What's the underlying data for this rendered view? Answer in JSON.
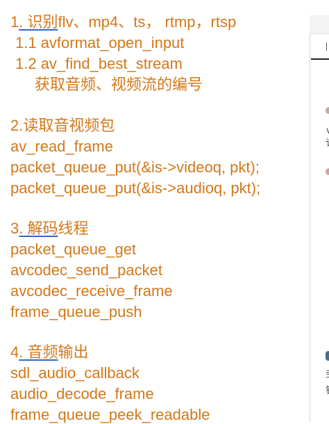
{
  "doc": {
    "s1_num": "1",
    "s1_ul": ". 识别",
    "s1_rest": "flv、mp4、ts， rtmp，rtsp",
    "s1_1": "1.1 avformat_open_input",
    "s1_2": "1.2  av_find_best_stream",
    "s1_2b": "获取音频、视频流的编号",
    "s2_title": "2.读取音视频包",
    "s2_l1": "av_read_frame",
    "s2_l2": "packet_queue_put(&is->videoq, pkt);",
    "s2_l3": "packet_queue_put(&is->audioq, pkt);",
    "s3_num": "3",
    "s3_ul": ". 解码",
    "s3_rest": "线程",
    "s3_l1": "packet_queue_get",
    "s3_l2": "avcodec_send_packet",
    "s3_l3": "avcodec_receive_frame",
    "s3_l4": "frame_queue_push",
    "s4_num": "4",
    "s4_ul": ". 音频",
    "s4_rest": "输出",
    "s4_l1": "sdl_audio_callback",
    "s4_l2": "audio_decode_frame",
    "s4_l3": "frame_queue_peek_readable"
  },
  "side": {
    "g1": "v",
    "g2": "讠",
    "g3": "弐",
    "g4": "钅"
  },
  "colors": {
    "text": "#d2781a",
    "underline": "#3366cc",
    "scroll_indicator": "#4a6e8a"
  }
}
